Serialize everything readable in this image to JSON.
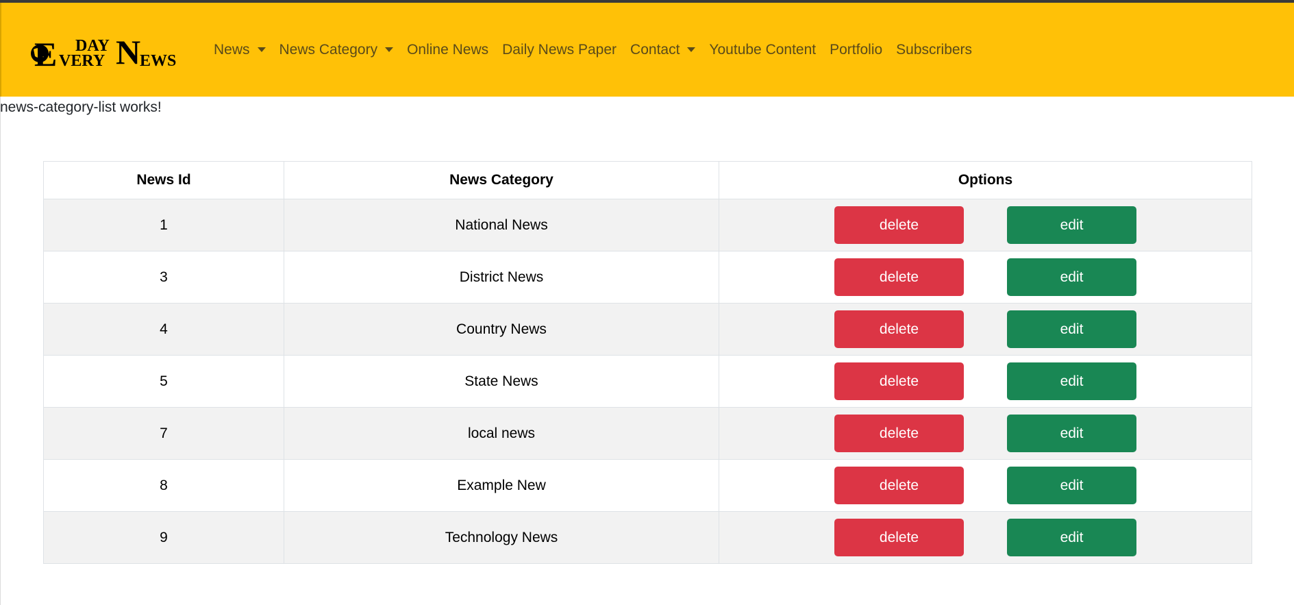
{
  "brand": {
    "logo_text": "EVERY DAY NEWS",
    "logo_parts": {
      "e": "E",
      "day": "DAY",
      "very": "VERY",
      "n": "N",
      "ews": "EWS"
    }
  },
  "nav": {
    "items": [
      {
        "label": "News",
        "dropdown": true
      },
      {
        "label": "News Category",
        "dropdown": true
      },
      {
        "label": "Online News",
        "dropdown": false
      },
      {
        "label": "Daily News Paper",
        "dropdown": false
      },
      {
        "label": "Contact",
        "dropdown": true
      },
      {
        "label": "Youtube Content",
        "dropdown": false
      },
      {
        "label": "Portfolio",
        "dropdown": false
      },
      {
        "label": "Subscribers",
        "dropdown": false
      }
    ]
  },
  "page": {
    "works_text": "news-category-list works!"
  },
  "table": {
    "headers": [
      "News Id",
      "News Category",
      "Options"
    ],
    "delete_label": "delete",
    "edit_label": "edit",
    "rows": [
      {
        "id": "1",
        "category": "National News"
      },
      {
        "id": "3",
        "category": "District News"
      },
      {
        "id": "4",
        "category": "Country News"
      },
      {
        "id": "5",
        "category": "State News"
      },
      {
        "id": "7",
        "category": "local news"
      },
      {
        "id": "8",
        "category": "Example New"
      },
      {
        "id": "9",
        "category": "Technology News"
      }
    ]
  },
  "colors": {
    "navbar": "#ffc107",
    "delete": "#dc3545",
    "edit": "#198754",
    "stripe": "#f2f2f2"
  }
}
